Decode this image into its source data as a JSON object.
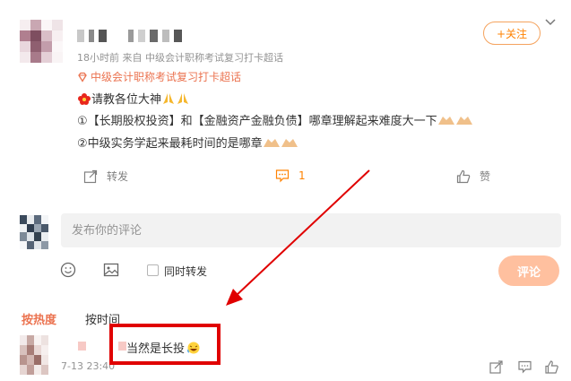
{
  "colors": {
    "accent": "#ff8200",
    "topic": "#eb7350",
    "annotation": "#e00000"
  },
  "post": {
    "meta": "18小时前  来自 中级会计职称考试复习打卡超话",
    "supertopic": "中级会计职称考试复习打卡超话",
    "follow_label": "+关注",
    "line1": "请教各位大神",
    "line2": "①【长期股权投资】和【金融资产金融负债】哪章理解起来难度大一下",
    "line3": "②中级实务学起来最耗时间的是哪章"
  },
  "actions": {
    "repost_label": "转发",
    "comment_count": "1",
    "like_label": "赞"
  },
  "composer": {
    "placeholder": "发布你的评论",
    "repost_label": "同时转发",
    "submit_label": "评论"
  },
  "sort": {
    "hot_label": "按热度",
    "time_label": "按时间"
  },
  "comment": {
    "text": "当然是长投",
    "time": "7-13 23:40"
  },
  "icons": [
    "chevron-down-icon",
    "supertopic-icon",
    "flower-emoji",
    "pray-emoji",
    "repost-icon",
    "comment-icon",
    "like-icon",
    "smile-icon",
    "image-icon",
    "share-icon",
    "reply-icon",
    "laugh-emoji"
  ]
}
